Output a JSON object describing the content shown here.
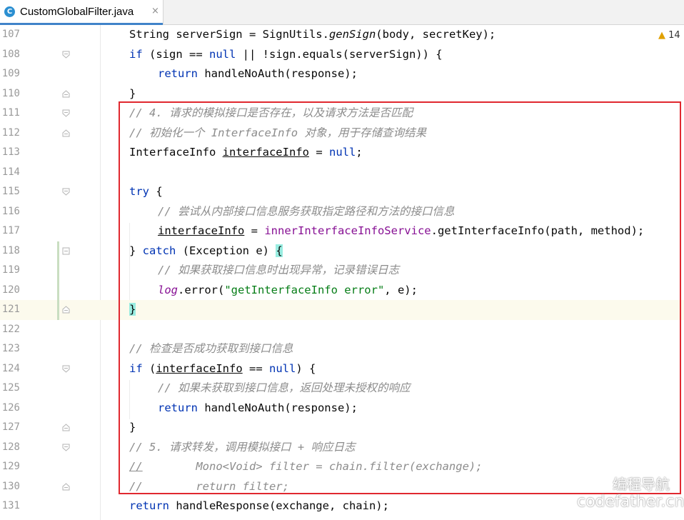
{
  "tab": {
    "icon_letter": "C",
    "filename": "CustomGlobalFilter.java",
    "close": "×"
  },
  "inspection": {
    "icon": "warning-icon",
    "count": "14"
  },
  "watermark": {
    "cn": "编程导航",
    "url": "codefather.cn"
  },
  "colors": {
    "keyword": "#0033b3",
    "comment": "#8c8c8c",
    "string": "#067d17",
    "field": "#871094",
    "highlight_box": "#e0282f"
  },
  "lines": [
    {
      "num": "107"
    },
    {
      "num": "108"
    },
    {
      "num": "109"
    },
    {
      "num": "110"
    },
    {
      "num": "111"
    },
    {
      "num": "112"
    },
    {
      "num": "113"
    },
    {
      "num": "114"
    },
    {
      "num": "115"
    },
    {
      "num": "116"
    },
    {
      "num": "117"
    },
    {
      "num": "118"
    },
    {
      "num": "119"
    },
    {
      "num": "120"
    },
    {
      "num": "121"
    },
    {
      "num": "122"
    },
    {
      "num": "123"
    },
    {
      "num": "124"
    },
    {
      "num": "125"
    },
    {
      "num": "126"
    },
    {
      "num": "127"
    },
    {
      "num": "128"
    },
    {
      "num": "129"
    },
    {
      "num": "130"
    },
    {
      "num": "131"
    }
  ],
  "code": {
    "l107": {
      "a": "String serverSign = SignUtils.",
      "b": "genSign",
      "c": "(body, secretKey);"
    },
    "l108": {
      "kw1": "if",
      "a": " (sign == ",
      "kw2": "null",
      "b": " || !sign.equals(serverSign)) {"
    },
    "l109": {
      "kw": "return",
      "a": " handleNoAuth(response);"
    },
    "l110": {
      "a": "}"
    },
    "l111": {
      "cm": "// 4. 请求的模拟接口是否存在，以及请求方法是否匹配"
    },
    "l112": {
      "cm": "// 初始化一个 InterfaceInfo 对象，用于存储查询结果"
    },
    "l113": {
      "a": "InterfaceInfo ",
      "v": "interfaceInfo",
      "b": " = ",
      "kw": "null",
      "c": ";"
    },
    "l115": {
      "kw": "try",
      "a": " {"
    },
    "l116": {
      "cm": "// 尝试从内部接口信息服务获取指定路径和方法的接口信息"
    },
    "l117": {
      "v": "interfaceInfo",
      "a": " = ",
      "f": "innerInterfaceInfoService",
      "b": ".getInterfaceInfo(path, method);"
    },
    "l118": {
      "a": "} ",
      "kw": "catch",
      "b": " (Exception e) ",
      "br": "{"
    },
    "l119": {
      "cm": "// 如果获取接口信息时出现异常，记录错误日志"
    },
    "l120": {
      "f": "log",
      "a": ".error(",
      "s": "\"getInterfaceInfo error\"",
      "b": ", e);"
    },
    "l121": {
      "br": "}"
    },
    "l123": {
      "cm": "// 检查是否成功获取到接口信息"
    },
    "l124": {
      "kw1": "if",
      "a": " (",
      "v": "interfaceInfo",
      "b": " == ",
      "kw2": "null",
      "c": ") {"
    },
    "l125": {
      "cm": "// 如果未获取到接口信息，返回处理未授权的响应"
    },
    "l126": {
      "kw": "return",
      "a": " handleNoAuth(response);"
    },
    "l127": {
      "a": "}"
    },
    "l128": {
      "cm": "// 5. 请求转发，调用模拟接口 + 响应日志"
    },
    "l129": {
      "cm1": "//",
      "cm2": "        Mono<Void> filter = chain.filter(exchange);"
    },
    "l130": {
      "cm1": "//",
      "cm2": "        return filter;"
    },
    "l131": {
      "kw": "return",
      "a": " handleResponse(exchange, chain);"
    }
  }
}
